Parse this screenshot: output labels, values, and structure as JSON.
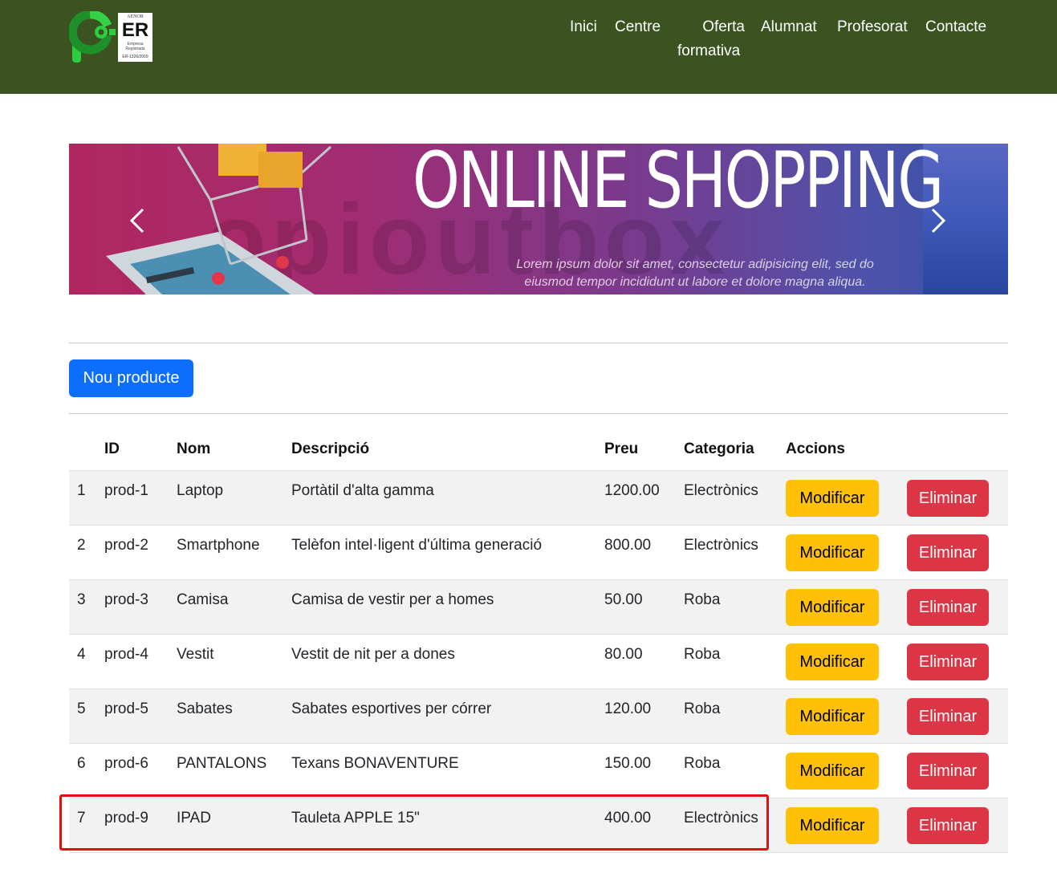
{
  "header": {
    "logo_badge": {
      "org": "AENOR",
      "mark": "ER",
      "caption": "Empresa Registrada",
      "cert": "ER-1326/2009"
    },
    "nav": [
      {
        "label": "Inici"
      },
      {
        "label": "Centre"
      },
      {
        "label_line1": "Oferta",
        "label_line2": "formativa"
      },
      {
        "label": "Alumnat"
      },
      {
        "label": "Profesorat"
      },
      {
        "label": "Contacte"
      }
    ]
  },
  "banner": {
    "title": "ONLINE SHOPPING",
    "watermark": "opioutbox",
    "subtitle_line1": "Lorem ipsum dolor sit amet, consectetur adipisicing elit, sed do",
    "subtitle_line2": "eiusmod tempor incididunt ut labore et dolore magna aliqua.",
    "prev_icon": "chevron-left-icon",
    "next_icon": "chevron-right-icon"
  },
  "actions": {
    "new_product": "Nou producte"
  },
  "table": {
    "headers": {
      "num": "",
      "id": "ID",
      "name": "Nom",
      "desc": "Descripció",
      "price": "Preu",
      "category": "Categoria",
      "actions": "Accions"
    },
    "modify_label": "Modificar",
    "delete_label": "Eliminar",
    "rows": [
      {
        "num": "1",
        "id": "prod-1",
        "name": "Laptop",
        "desc": "Portàtil d'alta gamma",
        "price": "1200.00",
        "category": "Electrònics"
      },
      {
        "num": "2",
        "id": "prod-2",
        "name": "Smartphone",
        "desc": "Telèfon intel·ligent d'última generació",
        "price": "800.00",
        "category": "Electrònics"
      },
      {
        "num": "3",
        "id": "prod-3",
        "name": "Camisa",
        "desc": "Camisa de vestir per a homes",
        "price": "50.00",
        "category": "Roba"
      },
      {
        "num": "4",
        "id": "prod-4",
        "name": "Vestit",
        "desc": "Vestit de nit per a dones",
        "price": "80.00",
        "category": "Roba"
      },
      {
        "num": "5",
        "id": "prod-5",
        "name": "Sabates",
        "desc": "Sabates esportives per córrer",
        "price": "120.00",
        "category": "Roba"
      },
      {
        "num": "6",
        "id": "prod-6",
        "name": "PANTALONS",
        "desc": "Texans BONAVENTURE",
        "price": "150.00",
        "category": "Roba"
      },
      {
        "num": "7",
        "id": "prod-9",
        "name": "IPAD",
        "desc": "Tauleta APPLE 15\"",
        "price": "400.00",
        "category": "Electrònics"
      }
    ]
  },
  "colors": {
    "header_bg": "#3a5320",
    "primary": "#0d6efd",
    "warning": "#ffc107",
    "danger": "#dc3545",
    "highlight": "#e01010"
  }
}
